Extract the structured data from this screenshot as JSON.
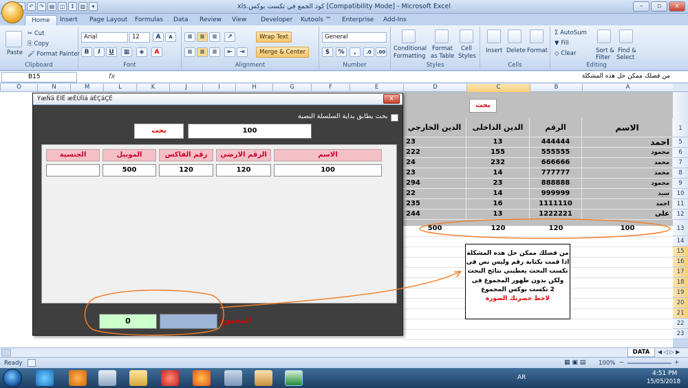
{
  "window": {
    "title": "xls.كود الجمع في تكست بوكس  [Compatibility Mode] - Microsoft Excel",
    "buttons": {
      "minimize": "–",
      "maximize": "▫",
      "close": "x"
    }
  },
  "ribbon": {
    "tabs": [
      "Home",
      "Insert",
      "Page Layout",
      "Formulas",
      "Data",
      "Review",
      "View",
      "Developer",
      "Kutools ™",
      "Enterprise",
      "Add-Ins"
    ],
    "active_tab": "Home",
    "clipboard": {
      "paste": "Paste",
      "cut": "Cut",
      "copy": "Copy",
      "format_painter": "Format Painter",
      "label": "Clipboard"
    },
    "font": {
      "name": "Arial",
      "size": "12",
      "grow": "A",
      "shrink": "A",
      "bold": "B",
      "italic": "I",
      "underline": "U",
      "label": "Font",
      "font_color": "#ff0000"
    },
    "alignment": {
      "wrap": "Wrap Text",
      "merge": "Merge & Center",
      "label": "Alignment"
    },
    "number": {
      "format": "General",
      "currency": "$",
      "percent": "%",
      "comma": ",",
      "label": "Number"
    },
    "styles": {
      "conditional": "Conditional",
      "conditional2": "Formatting",
      "format_table": "Format",
      "format_table2": "as Table",
      "cell_styles": "Cell",
      "cell_styles2": "Styles",
      "label": "Styles"
    },
    "cells": {
      "insert": "Insert",
      "delete": "Delete",
      "format": "Format",
      "label": "Cells"
    },
    "editing": {
      "autosum": "AutoSum",
      "fill": "Fill",
      "clear": "Clear",
      "sort": "Sort &",
      "sort2": "Filter",
      "find": "Find &",
      "find2": "Select",
      "label": "Editing"
    }
  },
  "formula_bar": {
    "name_box": "B15",
    "fx": "fx",
    "content": "من فضلك ممكن حل هذه المشكلة"
  },
  "columns": [
    "O",
    "N",
    "M",
    "L",
    "K",
    "J",
    "I",
    "H",
    "G",
    "F",
    "E",
    "D",
    "C",
    "B",
    "A"
  ],
  "selected_column": "C",
  "rows": [
    "1",
    "5",
    "6",
    "7",
    "8",
    "9",
    "10",
    "11",
    "12",
    "13",
    "14",
    "15",
    "16",
    "17",
    "18",
    "19",
    "20",
    "21",
    "22",
    "23"
  ],
  "sheet": {
    "search_button": "بحث",
    "headers": {
      "name": "الاسم",
      "number": "الرقم",
      "internal_debt": "الدين الداخلى",
      "external_debt": "الدين الخارجي"
    },
    "data": [
      {
        "name": "احمد",
        "number": "444444",
        "internal": "13",
        "external": "23"
      },
      {
        "name": "محمود",
        "number": "555555",
        "internal": "155",
        "external": "222"
      },
      {
        "name": "محمد",
        "number": "666666",
        "internal": "232",
        "external": "24"
      },
      {
        "name": "محمد",
        "number": "777777",
        "internal": "14",
        "external": "23"
      },
      {
        "name": "محمود",
        "number": "888888",
        "internal": "23",
        "external": "294"
      },
      {
        "name": "سيد",
        "number": "999999",
        "internal": "14",
        "external": "22"
      },
      {
        "name": "احمد",
        "number": "1111110",
        "internal": "16",
        "external": "235"
      },
      {
        "name": "على",
        "number": "1222221",
        "internal": "13",
        "external": "244"
      }
    ],
    "result_row": {
      "a": "100",
      "b": "120",
      "c": "120",
      "d": "500"
    }
  },
  "dialog": {
    "title": "ÝæÑã ÈÍË æÊÚÏíá áÈÇäÇÊ",
    "close": "x",
    "checkbox_label": "بحث يطابق بداية السلسلة النصية",
    "search_button": "بحث",
    "search_value": "100",
    "columns": [
      "الاسم",
      "الرقم الارضي",
      "رقم الفاكس",
      "الموبيل",
      "الجنسية"
    ],
    "values": [
      "100",
      "120",
      "120",
      "500",
      ""
    ],
    "total_label": "المجموع",
    "total_value": "0",
    "total_box2": ""
  },
  "note": {
    "lines": [
      "من فضلك ممكن حل هذه المشكلة",
      "اذا قمت بكتابة رقم وليس نص فى",
      "تكست البحث يعطينى نتائج البحث",
      "ولكن بدون ظهور المجموع فى",
      "2 تكست بوكس المجموع"
    ],
    "red_line": "لاحظ حضرتك الصورة"
  },
  "sheet_tab": "DATA",
  "status": {
    "ready": "Ready",
    "zoom": "100%",
    "minus": "−",
    "plus": "+"
  },
  "taskbar": {
    "lang": "AR",
    "time": "4:51 PM",
    "date": "15/05/2018"
  }
}
